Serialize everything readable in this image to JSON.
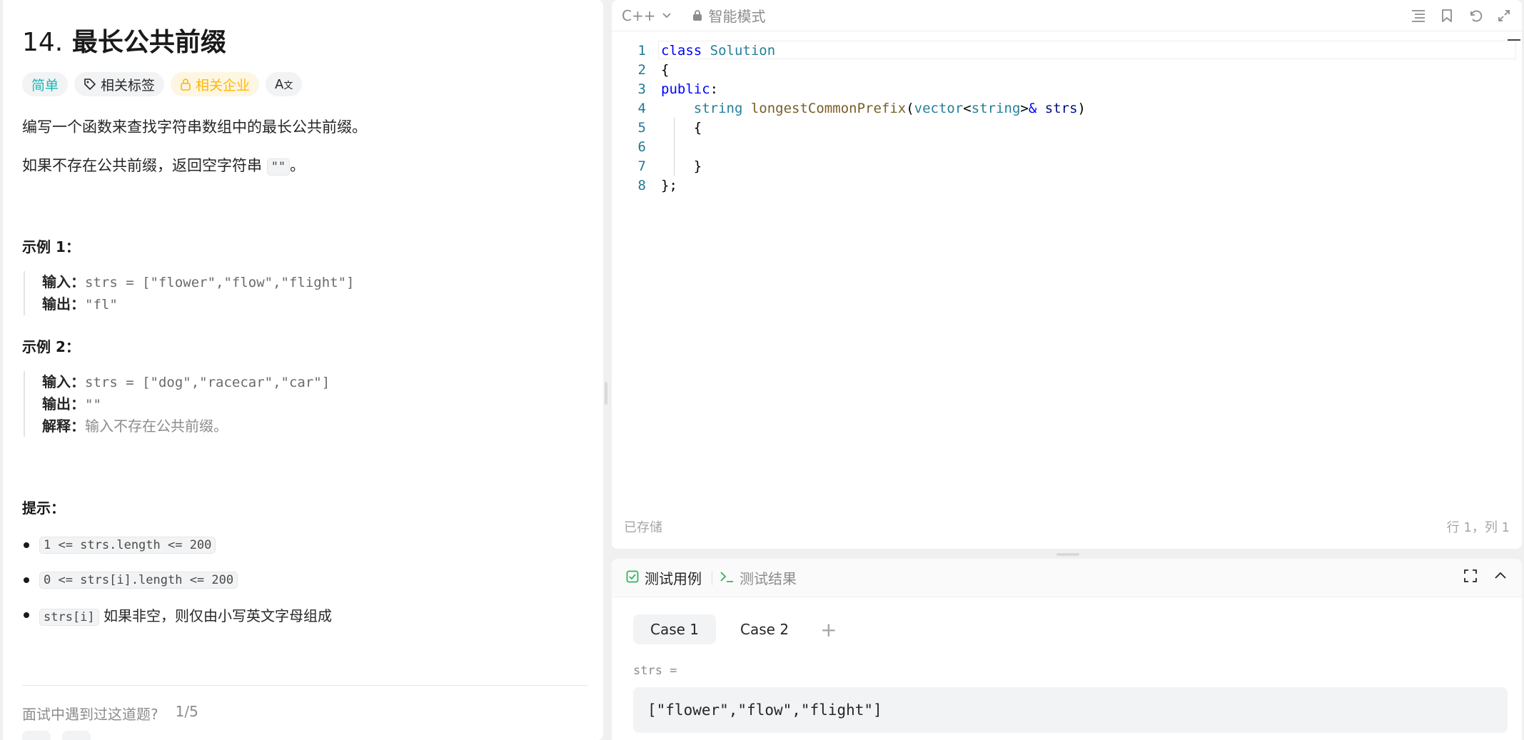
{
  "problem": {
    "number": "14.",
    "title": "最长公共前缀",
    "tags": {
      "difficulty": "简单",
      "related_tags": "相关标签",
      "related_companies": "相关企业",
      "translate": "A"
    },
    "description_1": "编写一个函数来查找字符串数组中的最长公共前缀。",
    "description_2_pre": "如果不存在公共前缀，返回空字符串 ",
    "description_2_code": "\"\"",
    "description_2_post": "。",
    "examples": [
      {
        "heading": "示例 1：",
        "input_label": "输入：",
        "input_value": "strs = [\"flower\",\"flow\",\"flight\"]",
        "output_label": "输出：",
        "output_value": "\"fl\""
      },
      {
        "heading": "示例 2：",
        "input_label": "输入：",
        "input_value": "strs = [\"dog\",\"racecar\",\"car\"]",
        "output_label": "输出：",
        "output_value": "\"\"",
        "explain_label": "解释：",
        "explain_value": "输入不存在公共前缀。"
      }
    ],
    "hints_heading": "提示：",
    "hints": [
      {
        "code": "1 <= strs.length <= 200",
        "text": ""
      },
      {
        "code": "0 <= strs[i].length <= 200",
        "text": ""
      },
      {
        "code": "strs[i]",
        "text": " 如果非空，则仅由小写英文字母组成"
      }
    ],
    "interview_question": "面试中遇到过这道题?",
    "interview_count": "1/5"
  },
  "editor": {
    "language": "C++",
    "mode": "智能模式",
    "saved_status": "已存储",
    "cursor_position": "行 1，列 1",
    "line_numbers": [
      "1",
      "2",
      "3",
      "4",
      "5",
      "6",
      "7",
      "8"
    ]
  },
  "testcase": {
    "tab_cases": "测试用例",
    "tab_result": "测试结果",
    "cases": [
      "Case 1",
      "Case 2"
    ],
    "plus": "+",
    "var_label": "strs =",
    "var_value": "[\"flower\",\"flow\",\"flight\"]"
  },
  "colors": {
    "easy": "#1cb8b8",
    "company": "#ffb700",
    "keyword": "#0000ff",
    "type": "#267f99",
    "function": "#795e26",
    "param": "#001080",
    "check_icon": "#2db55d",
    "terminal_icon": "#2db55d"
  },
  "icons": [
    "tag-icon",
    "lock-icon",
    "translate-icon",
    "chevron-down-icon",
    "lock-icon",
    "format-icon",
    "bookmark-icon",
    "undo-icon",
    "expand-icon",
    "checkbox-icon",
    "terminal-icon",
    "fullscreen-icon",
    "chevron-up-icon"
  ]
}
